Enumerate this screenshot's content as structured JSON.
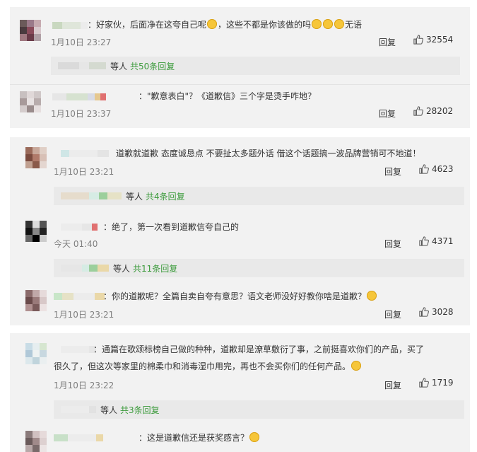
{
  "comments": [
    {
      "text": "：好家伙，后面净在这夸自己呢",
      "text_tail1": "，这些不都是你该做的吗",
      "text_tail2": "无语",
      "time": "1月10日 23:27",
      "reply": "回复",
      "likes": "32554"
    },
    {
      "text": "：\"歉意表白\"？《道歉信》三个字是烫手咋地？",
      "time": "1月10日 23:37",
      "reply": "回复",
      "likes": "28202"
    },
    {
      "text": "道歉就道歉 态度诚恳点 不要扯太多题外话 借这个话题搞一波品牌营销可不地道！",
      "time": "1月10日 23:21",
      "reply": "回复",
      "likes": "4623"
    },
    {
      "text": "：绝了，第一次看到道歉信夸自己的",
      "time": "今天 01:40",
      "reply": "回复",
      "likes": "4371"
    },
    {
      "text": "：你的道歉呢？全篇自卖自夸有意思？语文老师没好好教你啥是道歉？",
      "time": "1月10日 23:21",
      "reply": "回复",
      "likes": "3028"
    },
    {
      "text": "：通篇在歌颂标榜自己做的种种，道歉却是潦草敷衍了事，之前挺喜欢你们的产品，买了",
      "text_line2": "很久了，但这次等家里的棉柔巾和消毒湿巾用完，再也不会买你们的任何产品。",
      "time": "1月10日 23:22",
      "reply": "回复",
      "likes": "1719"
    },
    {
      "text": "：这是道歉信还是获奖感言？"
    }
  ],
  "reply_groups": [
    {
      "label": "等人",
      "count": "共50条回复"
    },
    {
      "label": "等人",
      "count": "共4条回复"
    },
    {
      "label": "等人",
      "count": "共11条回复"
    },
    {
      "label": "等人",
      "count": "共3条回复"
    }
  ],
  "colors": {
    "reply_link": "#3c9b3c",
    "panel_bg": "#f2f2f2",
    "reply_bg": "#e9e9e9",
    "time": "#808080"
  }
}
